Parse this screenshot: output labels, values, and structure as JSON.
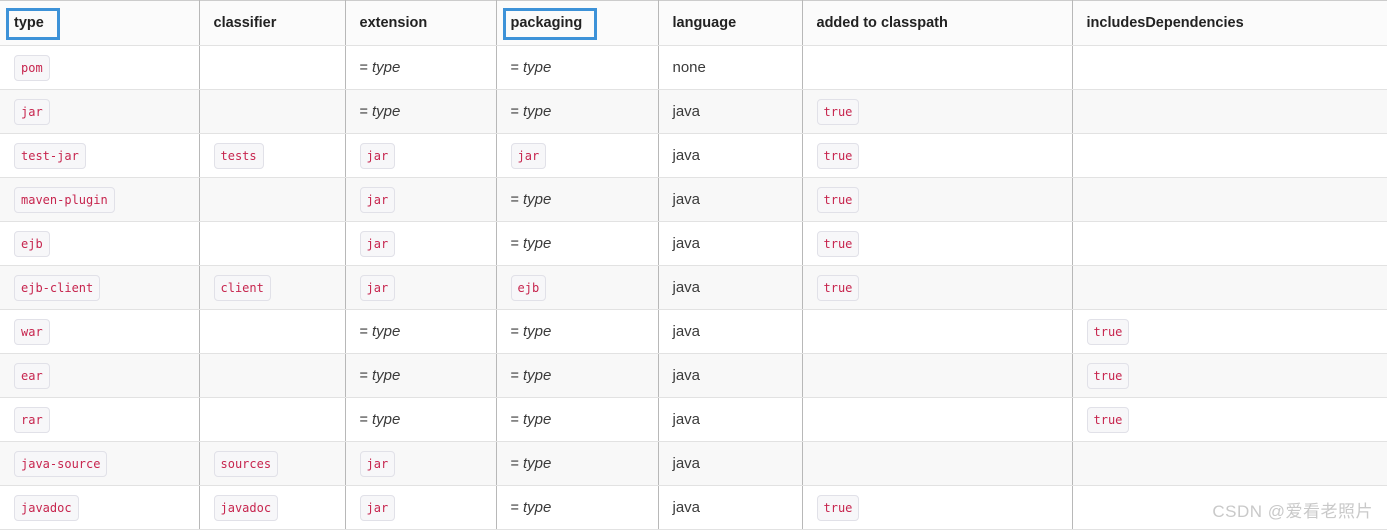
{
  "table": {
    "columns": [
      {
        "key": "type",
        "label": "type",
        "highlighted": true
      },
      {
        "key": "classifier",
        "label": "classifier",
        "highlighted": false
      },
      {
        "key": "extension",
        "label": "extension",
        "highlighted": false
      },
      {
        "key": "packaging",
        "label": "packaging",
        "highlighted": true
      },
      {
        "key": "language",
        "label": "language",
        "highlighted": false
      },
      {
        "key": "added_to_classpath",
        "label": "added to classpath",
        "highlighted": false
      },
      {
        "key": "includes_dependencies",
        "label": "includesDependencies",
        "highlighted": false
      }
    ],
    "rows": [
      {
        "type": "pom",
        "type_style": "code",
        "classifier": "",
        "classifier_style": "empty",
        "extension": "type",
        "extension_style": "eq",
        "packaging": "type",
        "packaging_style": "eq",
        "language": "none",
        "language_style": "plain",
        "added_to_classpath": "",
        "added_to_classpath_style": "empty",
        "includes_dependencies": "",
        "includes_dependencies_style": "empty"
      },
      {
        "type": "jar",
        "type_style": "code",
        "classifier": "",
        "classifier_style": "empty",
        "extension": "type",
        "extension_style": "eq",
        "packaging": "type",
        "packaging_style": "eq",
        "language": "java",
        "language_style": "plain",
        "added_to_classpath": "true",
        "added_to_classpath_style": "code",
        "includes_dependencies": "",
        "includes_dependencies_style": "empty"
      },
      {
        "type": "test-jar",
        "type_style": "code",
        "classifier": "tests",
        "classifier_style": "code",
        "extension": "jar",
        "extension_style": "code",
        "packaging": "jar",
        "packaging_style": "code",
        "language": "java",
        "language_style": "plain",
        "added_to_classpath": "true",
        "added_to_classpath_style": "code",
        "includes_dependencies": "",
        "includes_dependencies_style": "empty"
      },
      {
        "type": "maven-plugin",
        "type_style": "code",
        "classifier": "",
        "classifier_style": "empty",
        "extension": "jar",
        "extension_style": "code",
        "packaging": "type",
        "packaging_style": "eq",
        "language": "java",
        "language_style": "plain",
        "added_to_classpath": "true",
        "added_to_classpath_style": "code",
        "includes_dependencies": "",
        "includes_dependencies_style": "empty"
      },
      {
        "type": "ejb",
        "type_style": "code",
        "classifier": "",
        "classifier_style": "empty",
        "extension": "jar",
        "extension_style": "code",
        "packaging": "type",
        "packaging_style": "eq",
        "language": "java",
        "language_style": "plain",
        "added_to_classpath": "true",
        "added_to_classpath_style": "code",
        "includes_dependencies": "",
        "includes_dependencies_style": "empty"
      },
      {
        "type": "ejb-client",
        "type_style": "code",
        "classifier": "client",
        "classifier_style": "code",
        "extension": "jar",
        "extension_style": "code",
        "packaging": "ejb",
        "packaging_style": "code",
        "language": "java",
        "language_style": "plain",
        "added_to_classpath": "true",
        "added_to_classpath_style": "code",
        "includes_dependencies": "",
        "includes_dependencies_style": "empty"
      },
      {
        "type": "war",
        "type_style": "code",
        "classifier": "",
        "classifier_style": "empty",
        "extension": "type",
        "extension_style": "eq",
        "packaging": "type",
        "packaging_style": "eq",
        "language": "java",
        "language_style": "plain",
        "added_to_classpath": "",
        "added_to_classpath_style": "empty",
        "includes_dependencies": "true",
        "includes_dependencies_style": "code"
      },
      {
        "type": "ear",
        "type_style": "code",
        "classifier": "",
        "classifier_style": "empty",
        "extension": "type",
        "extension_style": "eq",
        "packaging": "type",
        "packaging_style": "eq",
        "language": "java",
        "language_style": "plain",
        "added_to_classpath": "",
        "added_to_classpath_style": "empty",
        "includes_dependencies": "true",
        "includes_dependencies_style": "code"
      },
      {
        "type": "rar",
        "type_style": "code",
        "classifier": "",
        "classifier_style": "empty",
        "extension": "type",
        "extension_style": "eq",
        "packaging": "type",
        "packaging_style": "eq",
        "language": "java",
        "language_style": "plain",
        "added_to_classpath": "",
        "added_to_classpath_style": "empty",
        "includes_dependencies": "true",
        "includes_dependencies_style": "code"
      },
      {
        "type": "java-source",
        "type_style": "code",
        "classifier": "sources",
        "classifier_style": "code",
        "extension": "jar",
        "extension_style": "code",
        "packaging": "type",
        "packaging_style": "eq",
        "language": "java",
        "language_style": "plain",
        "added_to_classpath": "",
        "added_to_classpath_style": "empty",
        "includes_dependencies": "",
        "includes_dependencies_style": "empty"
      },
      {
        "type": "javadoc",
        "type_style": "code",
        "classifier": "javadoc",
        "classifier_style": "code",
        "extension": "jar",
        "extension_style": "code",
        "packaging": "type",
        "packaging_style": "eq",
        "language": "java",
        "language_style": "plain",
        "added_to_classpath": "true",
        "added_to_classpath_style": "code",
        "includes_dependencies": "",
        "includes_dependencies_style": "empty"
      }
    ],
    "equals_prefix": "= "
  },
  "annotations": {
    "highlight_color": "#3d92d8",
    "highlighted_headers": [
      "type",
      "packaging"
    ]
  },
  "watermark": {
    "text": "CSDN @爱看老照片",
    "color": "#c9c9c9"
  },
  "colors": {
    "code_text": "#c7254e",
    "code_background": "#f7f7f9",
    "code_border": "#e1e1e8",
    "header_background": "#fbfbfb",
    "row_stripe": "#f8f8f8",
    "border": "#b8b8b8"
  }
}
